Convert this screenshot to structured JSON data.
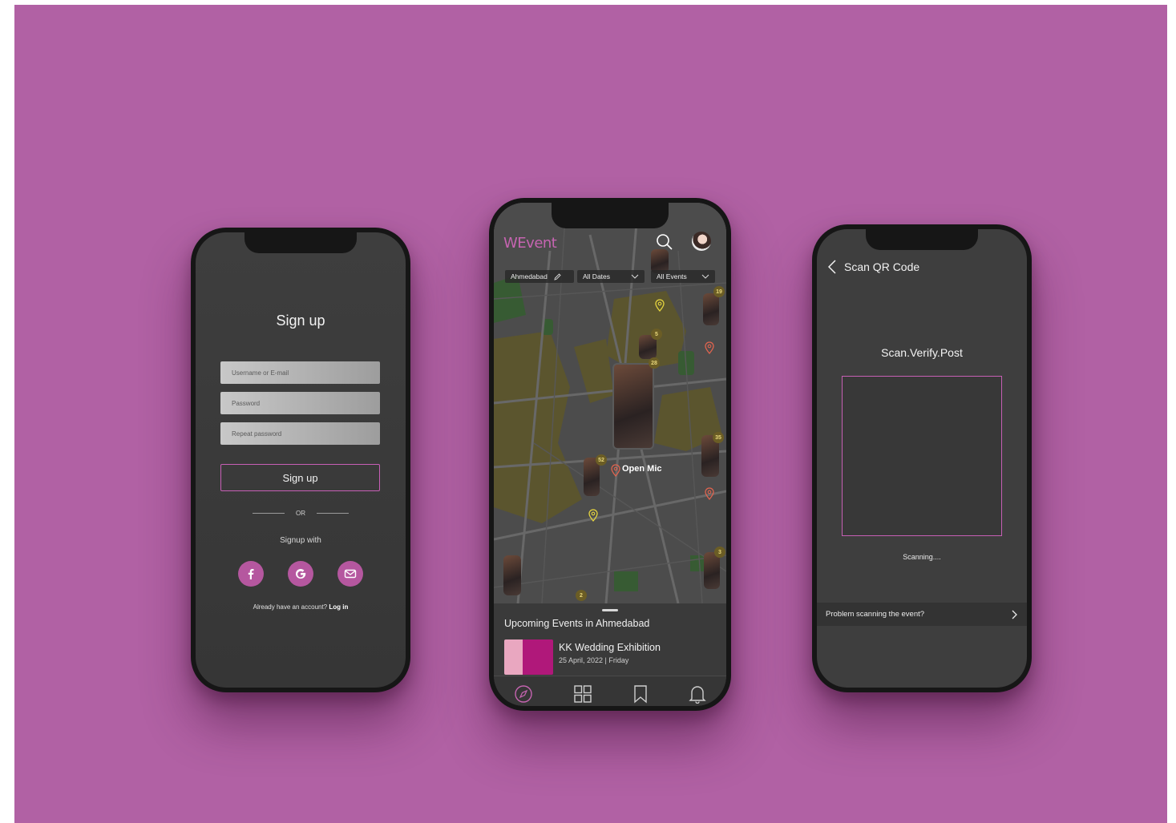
{
  "colors": {
    "backdrop": "#b161a4",
    "accent": "#c664b1",
    "screen": "#3d3d3d",
    "pin_yellow": "#e6d53f",
    "pin_red": "#e0644f"
  },
  "signup": {
    "title": "Sign up",
    "username_placeholder": "Username or E-mail",
    "password_placeholder": "Password",
    "repeat_placeholder": "Repeat password",
    "submit_label": "Sign up",
    "or_label": "OR",
    "signup_with_label": "Signup with",
    "socials": [
      "facebook-icon",
      "google-icon",
      "mail-icon"
    ],
    "login_prompt": "Already have an account?",
    "login_link": "Log in"
  },
  "map_screen": {
    "logo": "WEvent",
    "filters": {
      "city": "Ahmedabad",
      "dates": "All Dates",
      "events": "All Events"
    },
    "cluster_counts": [
      "19",
      "5",
      "28",
      "35",
      "52",
      "3",
      "2"
    ],
    "pin_label": "Open Mic",
    "sheet_title": "Upcoming Events in Ahmedabad",
    "event": {
      "name": "KK Wedding Exhibition",
      "date": "25 April, 2022 | Friday"
    },
    "tabs": [
      "compass-icon",
      "grid-icon",
      "bookmark-icon",
      "bell-icon"
    ]
  },
  "qr_screen": {
    "title": "Scan QR Code",
    "tagline": "Scan.Verify.Post",
    "status": "Scanning....",
    "help": "Problem scanning the event?"
  }
}
